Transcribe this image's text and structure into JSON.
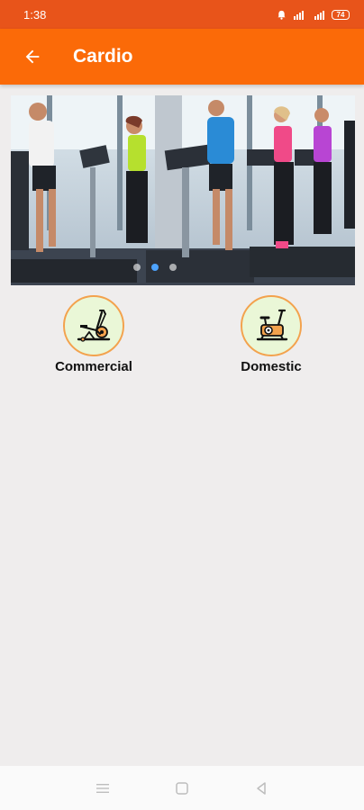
{
  "status_bar": {
    "time": "1:38",
    "battery": "74",
    "icons": [
      "alarm-icon",
      "wifi-icon",
      "signal-icon",
      "battery-icon"
    ]
  },
  "header": {
    "title": "Cardio",
    "back_icon": "arrow-left-icon"
  },
  "banner": {
    "image": "people running on treadmills in gym",
    "slide_count": 3,
    "active_slide": 2
  },
  "categories": [
    {
      "label": "Commercial",
      "icon": "elliptical-trainer-icon"
    },
    {
      "label": "Domestic",
      "icon": "exercise-bike-icon"
    }
  ],
  "nav": {
    "icons": [
      "menu-icon",
      "home-square-icon",
      "back-triangle-icon"
    ]
  },
  "colors": {
    "status_bar": "#e8541a",
    "app_bar": "#fb6a08",
    "background": "#efeded",
    "icon_circle_fill": "#eaf7d7",
    "icon_circle_border": "#f3a24d",
    "active_dot": "#4da3ff"
  }
}
